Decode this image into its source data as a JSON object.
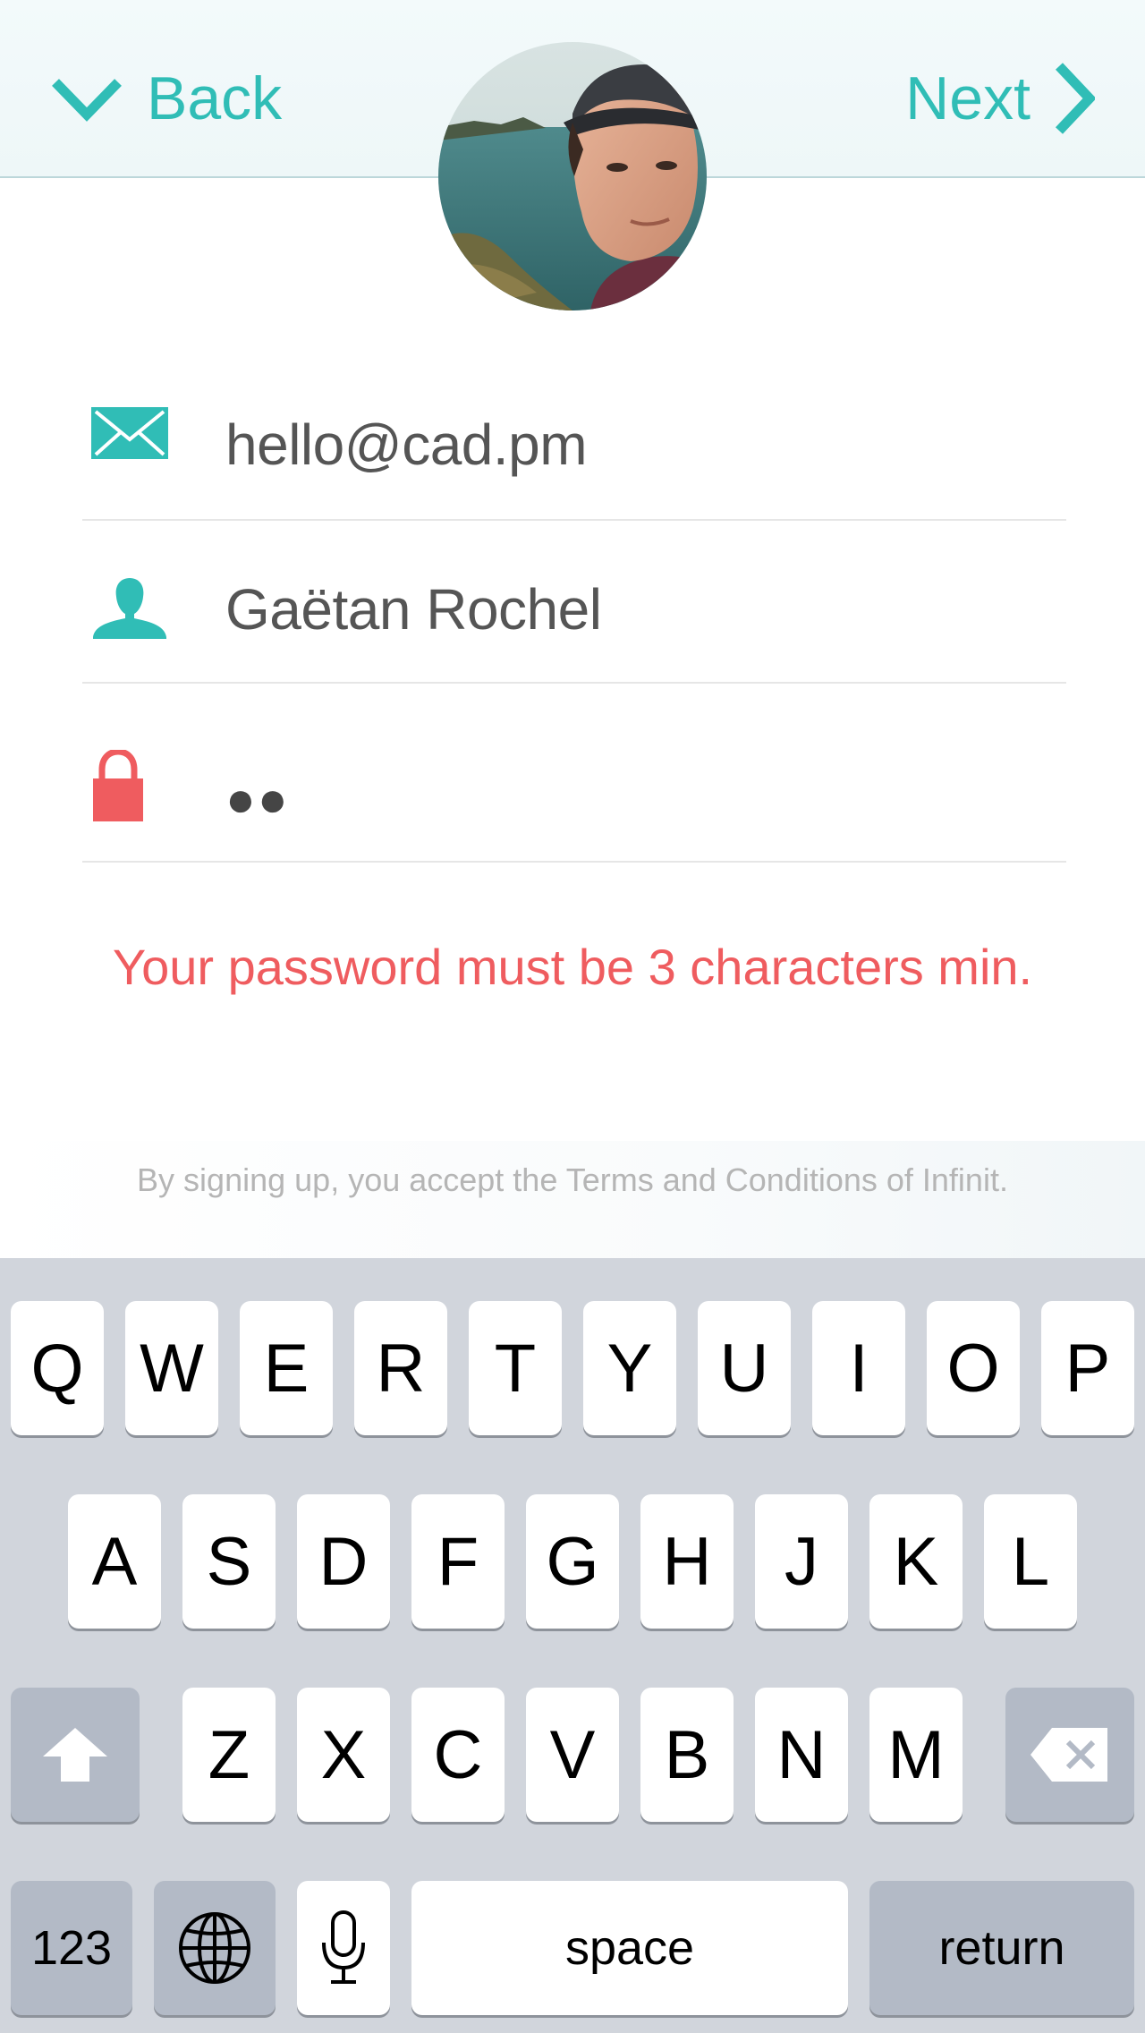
{
  "header": {
    "back_label": "Back",
    "next_label": "Next"
  },
  "form": {
    "email": "hello@cad.pm",
    "name": "Gaëtan Rochel",
    "password_mask": "●●"
  },
  "error_message": "Your password must be 3 characters min.",
  "terms_text": "By signing up, you accept the Terms and Conditions of Infinit.",
  "colors": {
    "accent": "#30bdb6",
    "error": "#ef5c5f",
    "keyboard_bg": "#d1d5dc"
  },
  "keyboard": {
    "row1": [
      "Q",
      "W",
      "E",
      "R",
      "T",
      "Y",
      "U",
      "I",
      "O",
      "P"
    ],
    "row2": [
      "A",
      "S",
      "D",
      "F",
      "G",
      "H",
      "J",
      "K",
      "L"
    ],
    "row3": [
      "Z",
      "X",
      "C",
      "V",
      "B",
      "N",
      "M"
    ],
    "numbers_label": "123",
    "space_label": "space",
    "return_label": "return"
  }
}
